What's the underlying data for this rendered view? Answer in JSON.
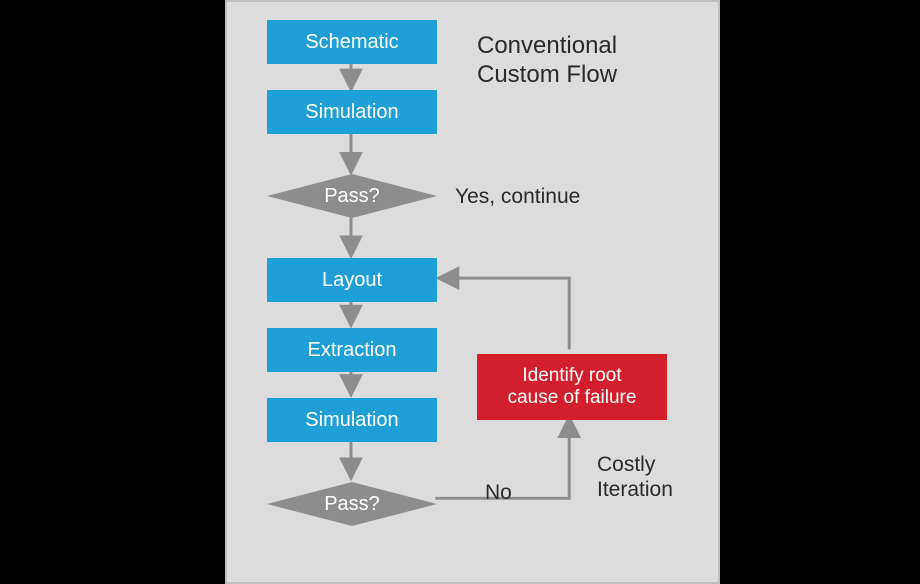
{
  "title_line1": "Conventional",
  "title_line2": "Custom Flow",
  "nodes": {
    "schematic": "Schematic",
    "simulation1": "Simulation",
    "pass1": "Pass?",
    "yes_continue": "Yes, continue",
    "layout": "Layout",
    "extraction": "Extraction",
    "simulation2": "Simulation",
    "pass2": "Pass?",
    "no_label": "No",
    "costly_line1": "Costly",
    "costly_line2": "Iteration",
    "root_line1": "Identify root",
    "root_line2": "cause of failure"
  },
  "chart_data": {
    "type": "flowchart",
    "title": "Conventional Custom Flow",
    "nodes": [
      {
        "id": "schematic",
        "type": "process",
        "label": "Schematic"
      },
      {
        "id": "sim1",
        "type": "process",
        "label": "Simulation"
      },
      {
        "id": "pass1",
        "type": "decision",
        "label": "Pass?"
      },
      {
        "id": "layout",
        "type": "process",
        "label": "Layout"
      },
      {
        "id": "extraction",
        "type": "process",
        "label": "Extraction"
      },
      {
        "id": "sim2",
        "type": "process",
        "label": "Simulation"
      },
      {
        "id": "pass2",
        "type": "decision",
        "label": "Pass?"
      },
      {
        "id": "root",
        "type": "process",
        "label": "Identify root cause of failure",
        "highlight": true
      }
    ],
    "edges": [
      {
        "from": "schematic",
        "to": "sim1"
      },
      {
        "from": "sim1",
        "to": "pass1"
      },
      {
        "from": "pass1",
        "to": "layout",
        "label": "Yes, continue"
      },
      {
        "from": "layout",
        "to": "extraction"
      },
      {
        "from": "extraction",
        "to": "sim2"
      },
      {
        "from": "sim2",
        "to": "pass2"
      },
      {
        "from": "pass2",
        "to": "root",
        "label": "No"
      },
      {
        "from": "root",
        "to": "layout",
        "label": "Costly Iteration"
      }
    ]
  }
}
